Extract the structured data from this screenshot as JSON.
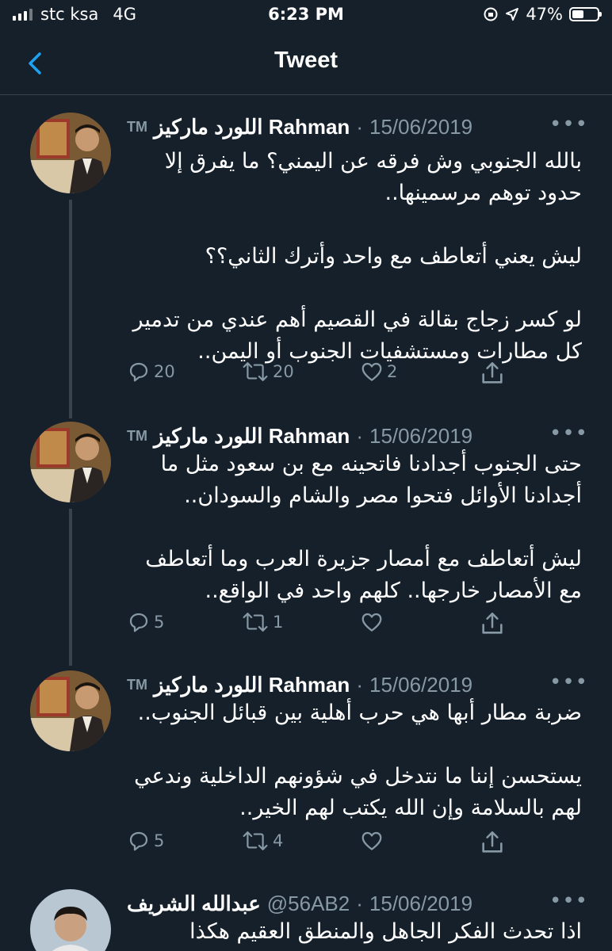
{
  "status": {
    "carrier": "stc ksa",
    "network": "4G",
    "time": "6:23 PM",
    "battery": "47%",
    "battery_level": 0.47
  },
  "nav": {
    "title": "Tweet"
  },
  "tweets": [
    {
      "tm": "TM",
      "name": "اللورد ماركيز Rahman",
      "date": "15/06/2019",
      "text": "بالله الجنوبي وش فرقه عن اليمني؟ ما يفرق إلا حدود توهم مرسمينها..\n\nليش يعني أتعاطف مع واحد وأترك الثاني؟؟\n\nلو كسر زجاج بقالة في القصيم أهم عندي من تدمير كل مطارات ومستشفيات الجنوب أو اليمن..",
      "replies": "20",
      "retweets": "20",
      "likes": "2"
    },
    {
      "tm": "TM",
      "name": "اللورد ماركيز Rahman",
      "date": "15/06/2019",
      "text": "حتى الجنوب أجدادنا فاتحينه مع بن سعود مثل ما أجدادنا الأوائل فتحوا مصر والشام والسودان..\n\nليش أتعاطف مع أمصار جزيرة العرب وما أتعاطف مع الأمصار خارجها.. كلهم واحد في الواقع..",
      "replies": "5",
      "retweets": "1",
      "likes": ""
    },
    {
      "tm": "TM",
      "name": "اللورد ماركيز Rahman",
      "date": "15/06/2019",
      "text": "ضربة مطار أبها هي حرب أهلية بين قبائل الجنوب..\n\nيستحسن إننا ما نتدخل في شؤونهم الداخلية وندعي لهم بالسلامة وإن الله يكتب لهم الخير..",
      "replies": "5",
      "retweets": "4",
      "likes": ""
    },
    {
      "name": "عبدالله الشريف",
      "handle": "@56AB2",
      "date": "15/06/2019",
      "text": "اذا تحدث الفكر الجاهل والمنطق العقيم هكذا"
    }
  ],
  "colors": {
    "background": "#15202b",
    "secondary_text": "#8899a6",
    "accent": "#1da1f2",
    "divider": "#38444d"
  },
  "icons": [
    "back-arrow-icon",
    "reply-icon",
    "retweet-icon",
    "like-icon",
    "share-icon",
    "more-icon",
    "signal-icon",
    "location-arrow-icon",
    "orientation-lock-icon",
    "battery-icon"
  ]
}
